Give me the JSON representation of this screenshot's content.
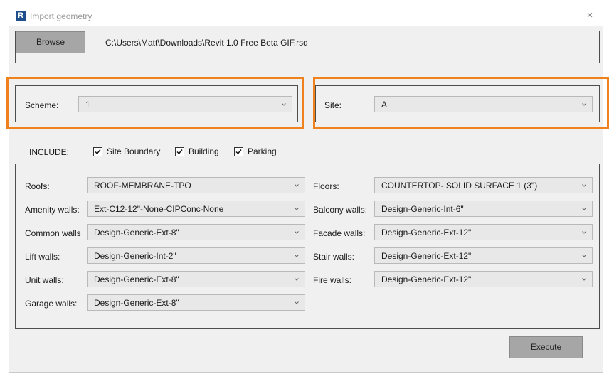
{
  "window": {
    "title": "Import geometry",
    "app_icon_letter": "R",
    "close_glyph": "×"
  },
  "browse": {
    "button_label": "Browse",
    "path": "C:\\Users\\Matt\\Downloads\\Revit 1.0 Free Beta GIF.rsd"
  },
  "scheme": {
    "label": "Scheme:",
    "value": "1"
  },
  "site": {
    "label": "Site:",
    "value": "A"
  },
  "include": {
    "label": "INCLUDE:",
    "options": [
      {
        "label": "Site Boundary",
        "checked": true
      },
      {
        "label": "Building",
        "checked": true
      },
      {
        "label": "Parking",
        "checked": true
      }
    ]
  },
  "materials": {
    "left": [
      {
        "label": "Roofs:",
        "value": "ROOF-MEMBRANE-TPO"
      },
      {
        "label": "Amenity walls:",
        "value": "Ext-C12-12\"-None-CIPConc-None"
      },
      {
        "label": "Common walls",
        "value": "Design-Generic-Ext-8\""
      },
      {
        "label": "Lift walls:",
        "value": "Design-Generic-Int-2\""
      },
      {
        "label": "Unit walls:",
        "value": "Design-Generic-Ext-8\""
      },
      {
        "label": "Garage walls:",
        "value": "Design-Generic-Ext-8\""
      }
    ],
    "right": [
      {
        "label": "Floors:",
        "value": "COUNTERTOP- SOLID SURFACE 1 (3\")"
      },
      {
        "label": "Balcony walls:",
        "value": "Design-Generic-Int-6\""
      },
      {
        "label": "Facade walls:",
        "value": "Design-Generic-Ext-12\""
      },
      {
        "label": "Stair walls:",
        "value": "Design-Generic-Ext-12\""
      },
      {
        "label": "Fire walls:",
        "value": "Design-Generic-Ext-12\""
      }
    ]
  },
  "execute_label": "Execute",
  "colors": {
    "highlight": "#f0821e",
    "button": "#a6a6a6",
    "dialog_bg": "#f0f0f0",
    "app_icon": "#1f4e8c"
  }
}
